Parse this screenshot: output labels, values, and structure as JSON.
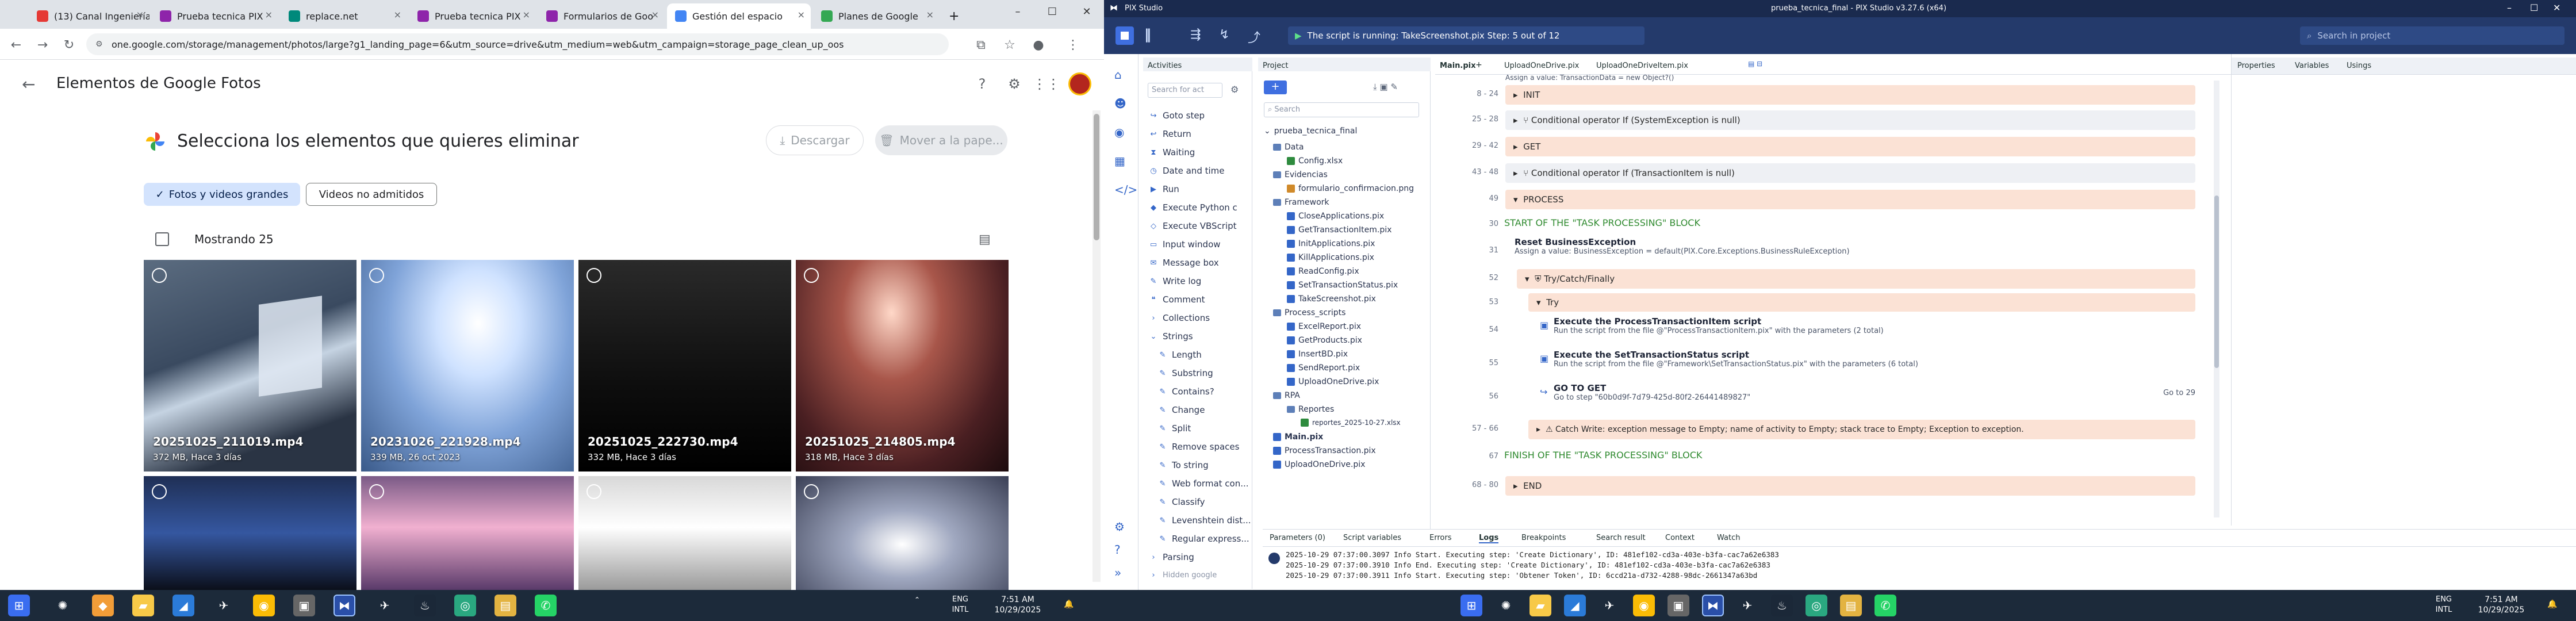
{
  "browser": {
    "tabs": [
      {
        "label": "(13) Canal Ingeniería",
        "color": "#e53935"
      },
      {
        "label": "Prueba tecnica PIX",
        "color": "#8e24aa"
      },
      {
        "label": "replace.net",
        "color": "#00897b"
      },
      {
        "label": "Prueba tecnica PIX",
        "color": "#8e24aa"
      },
      {
        "label": "Formularios de Goo",
        "color": "#8e24aa"
      },
      {
        "label": "Gestión del espacio",
        "color": "#4285f4"
      },
      {
        "label": "Planes de Google",
        "color": "#34a853"
      }
    ],
    "new_tab": "+",
    "url": "one.google.com/storage/management/photos/large?g1_landing_page=6&utm_source=drive&utm_medium=web&utm_campaign=storage_page_clean_up_oos"
  },
  "photos": {
    "back_icon": "arrow-back-icon",
    "title": "Elementos de Google Fotos",
    "heading": "Selecciona los elementos que quieres eliminar",
    "download_label": "Descargar",
    "move_label": "Mover a la pape...",
    "chips": [
      "Fotos y videos grandes",
      "Videos no admitidos"
    ],
    "showing": "Mostrando 25",
    "tiles": [
      {
        "name": "20251025_211019.mp4",
        "meta": "372 MB, Hace 3 días"
      },
      {
        "name": "20231026_221928.mp4",
        "meta": "339 MB, 26 oct 2023"
      },
      {
        "name": "20251025_222730.mp4",
        "meta": "332 MB, Hace 3 días"
      },
      {
        "name": "20251025_214805.mp4",
        "meta": "318 MB, Hace 3 días"
      }
    ]
  },
  "taskbar_left": {
    "time": "7:51 AM",
    "date": "10/29/2025",
    "lang": "ENG",
    "intl": "INTL"
  },
  "pix": {
    "title": "prueba_tecnica_final - PIX Studio v3.27.6 (x64)",
    "app_name": "PIX Studio",
    "status": "The script is running: TakeScreenshot.pix   Step: 5 out of 12",
    "search_placeholder": "Search in project",
    "activities_tab": "Activities",
    "project_tab": "Project",
    "act_search": "Search for act",
    "activities": [
      "Goto step",
      "Return",
      "Waiting",
      "Date and time",
      "Run",
      "Execute Python c",
      "Execute VBScript",
      "Input window",
      "Message box",
      "Write log",
      "Comment",
      "Collections",
      "Strings",
      "Length",
      "Substring",
      "Contains?",
      "Change",
      "Split",
      "Remove spaces",
      "To string",
      "Web format con...",
      "Classify",
      "Levenshtein dist...",
      "Regular express...",
      "Parsing",
      "Hidden google"
    ],
    "proj_search": "Search",
    "project_root": "prueba_tecnica_final",
    "project_items": [
      "Data",
      "Config.xlsx",
      "Evidencias",
      "formulario_confirmacion.png",
      "Framework",
      "CloseApplications.pix",
      "GetTransactionItem.pix",
      "InitApplications.pix",
      "KillApplications.pix",
      "ReadConfig.pix",
      "SetTransactionStatus.pix",
      "TakeScreenshot.pix",
      "Process_scripts",
      "ExcelReport.pix",
      "GetProducts.pix",
      "InsertBD.pix",
      "SendReport.pix",
      "UploadOneDrive.pix",
      "RPA",
      "Reportes",
      "reportes_2025-10-27.xlsx",
      "Main.pix",
      "ProcessTransaction.pix",
      "UploadOneDrive.pix"
    ],
    "doc_tabs": [
      "Main.pix",
      "UploadOneDrive.pix",
      "UploadOneDriveItem.pix"
    ],
    "code_header_line": "Assign a value: TransactionData = new Object?()",
    "lines": [
      {
        "no": "8 - 24",
        "text": "INIT",
        "kind": "grey"
      },
      {
        "no": "25 - 28",
        "text": "Conditional operator  If (SystemException is null)",
        "kind": "grey"
      },
      {
        "no": "29 - 42",
        "text": "GET",
        "kind": "grey"
      },
      {
        "no": "43 - 48",
        "text": "Conditional operator  If (TransactionItem is null)",
        "kind": "grey"
      },
      {
        "no": "49",
        "text": "PROCESS",
        "kind": "peach"
      }
    ],
    "comment1": "START OF THE \"TASK PROCESSING\" BLOCK",
    "reset_title": "Reset BusinessException",
    "reset_sub": "Assign a value: BusinessException = default(PIX.Core.Exceptions.BusinessRuleException)",
    "try_catch": "Try/Catch/Finally",
    "try_label": "Try",
    "exec1_title": "Execute the ProcessTransactionItem script",
    "exec1_sub": "Run the script from the file @\"ProcessTransactionItem.pix\" with the parameters (2 total)",
    "exec2_title": "Execute the SetTransactionStatus script",
    "exec2_sub": "Run the script from the file @\"Framework\\SetTransactionStatus.pix\" with the parameters (6 total)",
    "goto_title": "GO TO GET",
    "goto_sub": "Go to step \"60b0d9f-7d79-425d-80f2-26441489827\"",
    "goto_right": "Go to 29",
    "catch_text": "Catch  Write: exception message to Empty; name of activity to Empty; stack trace to Empty; Exception to exception.",
    "comment2": "FINISH OF THE \"TASK PROCESSING\" BLOCK",
    "end_label": "END",
    "line_numbers": [
      "30",
      "31",
      "52",
      "53",
      "54",
      "55",
      "56",
      "57 - 66",
      "67",
      "68 - 80"
    ],
    "right_tabs": [
      "Properties",
      "Variables",
      "Usings"
    ],
    "bottom_tabs": [
      "Parameters (0)",
      "Script variables",
      "Errors",
      "Logs",
      "Breakpoints",
      "Search result",
      "Context",
      "Watch"
    ],
    "logs": [
      "2025-10-29 07:37:00.3097 Info Start. Executing step: 'Create Dictionary', ID: 481ef102-cd3a-403e-b3fa-cac7a62e6383",
      "2025-10-29 07:37:00.3910 Info End. Executing step: 'Create Dictionary', ID: 481ef102-cd3a-403e-b3fa-cac7a62e6383",
      "2025-10-29 07:37:00.3911 Info Start. Executing step: 'Obtener Token', ID: 6ccd21a-d732-4288-98dc-2661347a63bd"
    ]
  },
  "taskbar_right": {
    "time": "7:51 AM",
    "date": "10/29/2025",
    "lang": "ENG",
    "intl": "INTL"
  }
}
